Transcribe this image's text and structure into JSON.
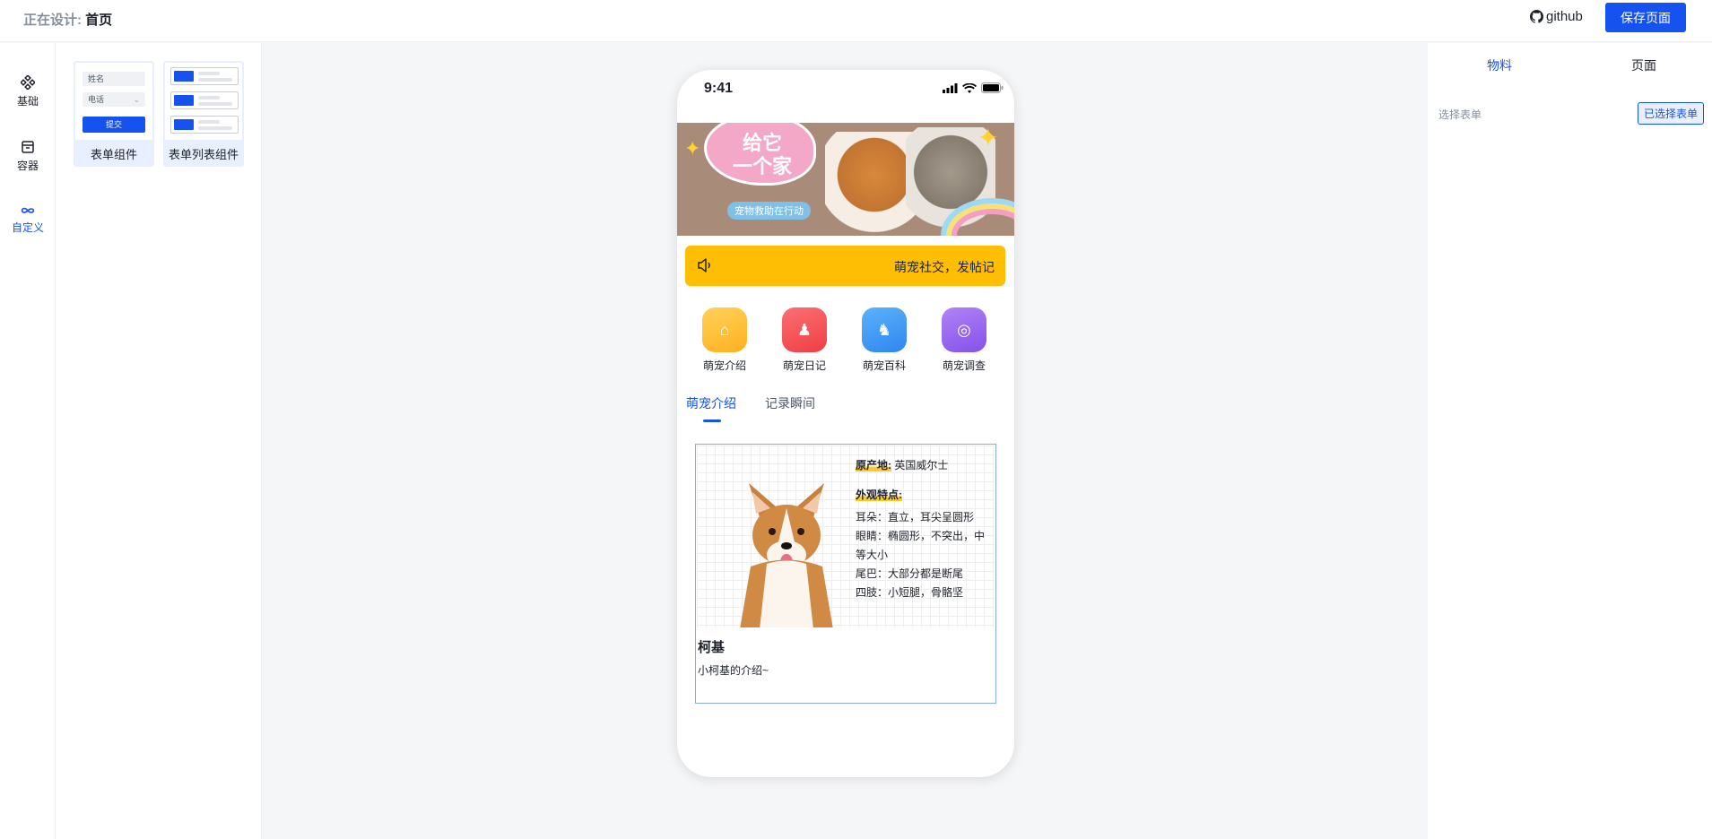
{
  "header": {
    "designing_label": "正在设计:",
    "page_name": "首页",
    "github_label": "github",
    "save_label": "保存页面"
  },
  "rail": {
    "items": [
      {
        "label": "基础",
        "icon": "component-icon"
      },
      {
        "label": "容器",
        "icon": "box-icon"
      },
      {
        "label": "自定义",
        "icon": "infinity-icon"
      }
    ]
  },
  "components": {
    "items": [
      {
        "name": "表单组件"
      },
      {
        "name": "表单列表组件"
      }
    ],
    "form_thumb": {
      "name_field": "姓名",
      "phone_field": "电话",
      "submit": "提交"
    }
  },
  "phone": {
    "time": "9:41",
    "banner": {
      "title": "给它\n一个家",
      "tag": "宠物救助在行动"
    },
    "notice": "萌宠社交，发帖记",
    "categories": [
      {
        "label": "萌宠介绍",
        "color": "#ffc42e"
      },
      {
        "label": "萌宠日记",
        "color": "#f4555a"
      },
      {
        "label": "萌宠百科",
        "color": "#3d98f6"
      },
      {
        "label": "萌宠调查",
        "color": "#9a63f0"
      }
    ],
    "tabs": [
      {
        "label": "萌宠介绍"
      },
      {
        "label": "记录瞬间"
      }
    ],
    "card": {
      "origin_label": "原产地:",
      "origin_value": "英国威尔士",
      "appearance_label": "外观特点:",
      "ears": "耳朵：直立，耳尖呈圆形",
      "eyes": "眼睛：椭圆形，不突出，中等大小",
      "tail": "尾巴：大部分都是断尾",
      "limbs": "四肢：小短腿，骨骼坚",
      "name": "柯基",
      "desc": "小柯基的介绍~"
    }
  },
  "right_panel": {
    "tabs": [
      {
        "label": "物料"
      },
      {
        "label": "页面"
      }
    ],
    "select_form_label": "选择表单",
    "selected_button": "已选择表单"
  }
}
